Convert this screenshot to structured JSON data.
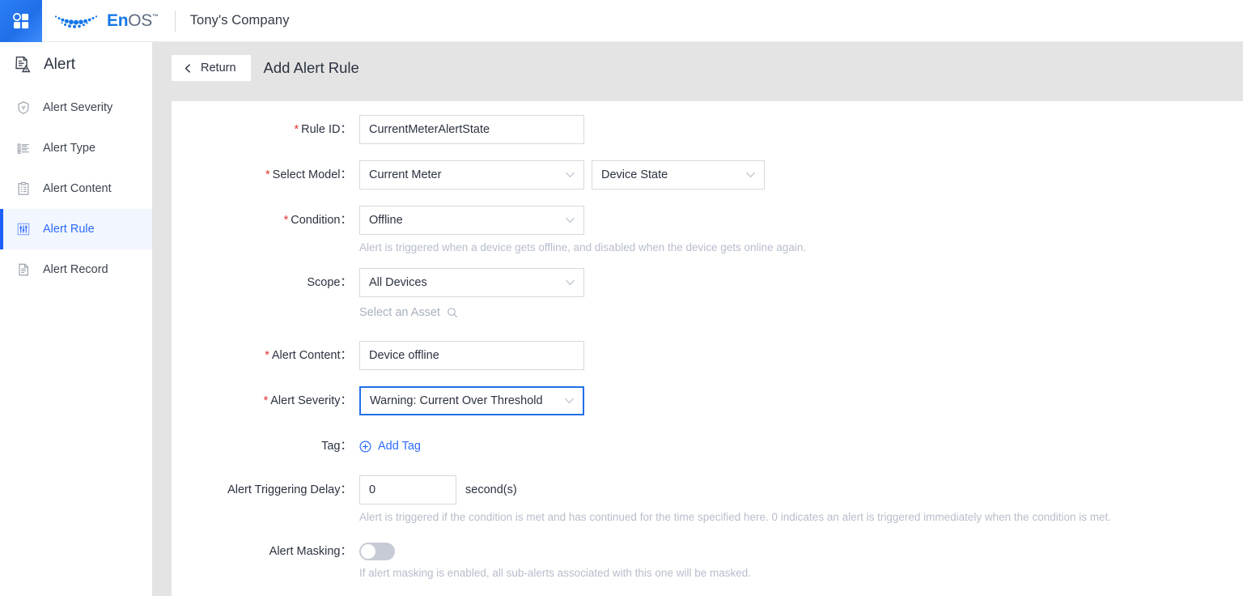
{
  "topbar": {
    "app_grid_icon": "app-grid-icon",
    "logo": {
      "part1": "En",
      "part2": "OS",
      "tm": "™"
    },
    "company": "Tony's Company"
  },
  "sidebar": {
    "header": {
      "label": "Alert",
      "icon": "alert-document-icon"
    },
    "items": [
      {
        "label": "Alert Severity",
        "icon": "shield-icon",
        "active": false
      },
      {
        "label": "Alert Type",
        "icon": "list-icon",
        "active": false
      },
      {
        "label": "Alert Content",
        "icon": "clipboard-icon",
        "active": false
      },
      {
        "label": "Alert Rule",
        "icon": "sliders-icon",
        "active": true
      },
      {
        "label": "Alert Record",
        "icon": "document-icon",
        "active": false
      }
    ]
  },
  "page": {
    "return_label": "Return",
    "title": "Add Alert Rule"
  },
  "form": {
    "rule_id": {
      "label": "Rule ID：",
      "required": true,
      "value": "CurrentMeterAlertState"
    },
    "select_model": {
      "label": "Select Model：",
      "required": true,
      "model_value": "Current Meter",
      "attribute_value": "Device State"
    },
    "condition": {
      "label": "Condition：",
      "required": true,
      "value": "Offline",
      "helper": "Alert is triggered when a device gets offline, and disabled when the device gets online again."
    },
    "scope": {
      "label": "Scope：",
      "required": false,
      "value": "All Devices",
      "asset_placeholder": "Select an Asset"
    },
    "alert_content": {
      "label": "Alert Content：",
      "required": true,
      "value": "Device offline"
    },
    "alert_severity": {
      "label": "Alert Severity：",
      "required": true,
      "value": "Warning: Current Over Threshold",
      "focused": true
    },
    "tag": {
      "label": "Tag：",
      "add_label": "Add Tag"
    },
    "delay": {
      "label": "Alert Triggering Delay：",
      "value": "0",
      "unit": "second(s)",
      "helper": "Alert is triggered if the condition is met and has continued for the time specified here. 0 indicates an alert is triggered immediately when the condition is met."
    },
    "masking": {
      "label": "Alert Masking：",
      "state": "off",
      "helper": "If alert masking is enabled, all sub-alerts associated with this one will be masked."
    }
  },
  "colors": {
    "accent": "#2f6bff",
    "required": "#e03131",
    "page_bg": "#e4e4e4",
    "helper_text": "#b7bdca"
  }
}
